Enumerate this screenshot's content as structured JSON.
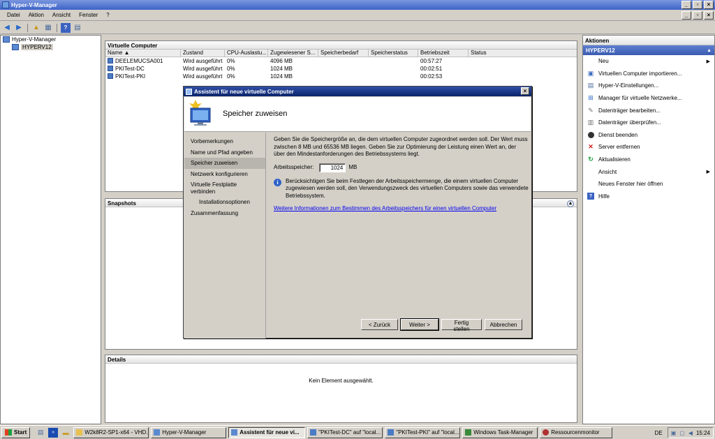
{
  "window": {
    "title": "Hyper-V-Manager"
  },
  "menu": [
    "Datei",
    "Aktion",
    "Ansicht",
    "Fenster",
    "?"
  ],
  "tree": {
    "root": "Hyper-V-Manager",
    "child": "HYPERV12"
  },
  "vm_panel": {
    "title": "Virtuelle Computer",
    "columns": [
      "Name",
      "Zustand",
      "CPU-Auslastu...",
      "Zugewiesener S...",
      "Speicherbedarf",
      "Speicherstatus",
      "Betriebszeit",
      "Status"
    ],
    "rows": [
      {
        "name": "DEELEMUCSA001",
        "state": "Wird ausgeführt",
        "cpu": "0%",
        "memory": "4096 MB",
        "uptime": "00:57:27"
      },
      {
        "name": "PKITest-DC",
        "state": "Wird ausgeführt",
        "cpu": "0%",
        "memory": "1024 MB",
        "uptime": "00:02:51"
      },
      {
        "name": "PKITest-PKI",
        "state": "Wird ausgeführt",
        "cpu": "0%",
        "memory": "1024 MB",
        "uptime": "00:02:53"
      }
    ]
  },
  "snapshots_panel": {
    "title": "Snapshots"
  },
  "details_panel": {
    "title": "Details",
    "empty_text": "Kein Element ausgewählt."
  },
  "actions": {
    "title": "Aktionen",
    "section": "HYPERV12",
    "items": [
      "Neu",
      "Virtuellen Computer importieren...",
      "Hyper-V-Einstellungen...",
      "Manager für virtuelle Netzwerke...",
      "Datenträger bearbeiten...",
      "Datenträger überprüfen...",
      "Dienst beenden",
      "Server entfernen",
      "Aktualisieren",
      "Ansicht",
      "Neues Fenster hier öffnen",
      "Hilfe"
    ]
  },
  "wizard": {
    "title": "Assistent für neue virtuelle Computer",
    "heading": "Speicher zuweisen",
    "steps": [
      "Vorbemerkungen",
      "Name und Pfad angeben",
      "Speicher zuweisen",
      "Netzwerk konfigurieren",
      "Virtuelle Festplatte verbinden",
      "Installationsoptionen",
      "Zusammenfassung"
    ],
    "description": "Geben Sie die Speichergröße an, die dem virtuellen Computer zugeordnet werden soll. Der Wert muss zwischen 8 MB und 65536 MB liegen. Geben Sie zur Optimierung der Leistung einen Wert an, der über den Mindestanforderungen des Betriebssystems liegt.",
    "memory_label": "Arbeitsspeicher:",
    "memory_value": "1024",
    "memory_unit": "MB",
    "info_text": "Berücksichtigen Sie beim Festlegen der Arbeitsspeichermenge, die einem virtuellen Computer zugewiesen werden soll, den Verwendungszweck des virtuellen Computers sowie das verwendete Betriebssystem.",
    "link_text": "Weitere Informationen zum Bestimmen des Arbeitsspeichers für einen virtuellen Computer",
    "buttons": {
      "back": "< Zurück",
      "next": "Weiter >",
      "finish": "Fertig stellen",
      "cancel": "Abbrechen"
    }
  },
  "taskbar": {
    "start": "Start",
    "tasks": [
      "W2k8R2-SP1-x64 - VHD...",
      "Hyper-V-Manager",
      "Assistent für neue vi...",
      "\"PKITest-DC\" auf \"local...",
      "\"PKITest-PKI\" auf \"local...",
      "Windows Task-Manager",
      "Ressourcenmonitor"
    ],
    "language": "DE",
    "clock": "15:24"
  },
  "colors": {
    "title_blue": "#3d63c8",
    "dialog_title": "#0a246a",
    "actions_section": "#3a5bb0",
    "link": "#0000ee"
  }
}
